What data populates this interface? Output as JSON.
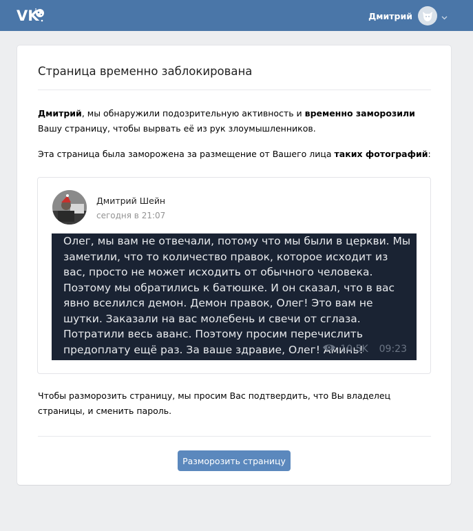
{
  "header": {
    "logo_icon": "vk-logo-icon",
    "user_name": "Дмитрий",
    "avatar_icon": "default-avatar-icon",
    "menu_icon": "chevron-down-icon"
  },
  "card": {
    "title": "Страница временно заблокирована",
    "intro": {
      "name": "Дмитрий",
      "part1": ", мы обнаружили подозрительную активность и ",
      "bold": "временно заморозили",
      "part2": " Вашу страницу, чтобы вырвать её из рук злоумышленников."
    },
    "reason": {
      "part1": "Эта страница была заморожена за размещение от Вашего лица ",
      "bold": "таких фотографий",
      "part2": ":"
    },
    "post": {
      "author": "Дмитрий Шейн",
      "time": "сегодня в 21:07",
      "video_text": "Олег, мы вам не отвечали, потому что мы были в церкви. Мы заметили, что то количество правок, которое исходит из вас, просто не может исходить от обычного человека. Поэтому мы обратились к батюшке. И он сказал, что в вас явно вселился демон. Демон правок, Олег! Это вам не шутки. Заказали на вас молебень и свечи от сглаза. Потратили весь аванс. Поэтому просим перечислить предоплату ещё раз. За ваше здравие, Олег! Аминь!",
      "views": "10.5K",
      "duration": "09:23",
      "views_icon": "eye-icon"
    },
    "instruction": "Чтобы разморозить страницу, мы просим Вас подтвердить, что Вы владелец страницы, и сменить пароль.",
    "button_label": "Разморозить страницу"
  },
  "colors": {
    "header_bg": "#4a76a8",
    "page_bg": "#edeef0",
    "button_bg": "#5b88bd",
    "video_bg": "#1a2333"
  }
}
